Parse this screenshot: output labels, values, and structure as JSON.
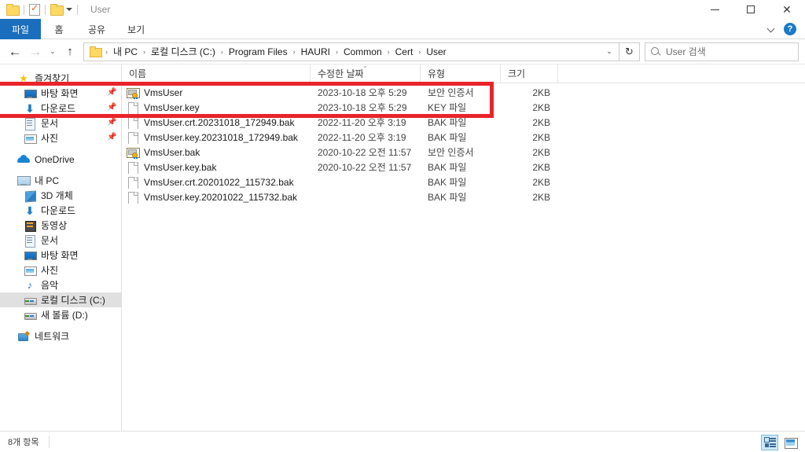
{
  "window": {
    "title": "User",
    "quick_access": [
      {
        "name": "folder-icon",
        "label": "새 폴더"
      },
      {
        "name": "properties-icon",
        "label": "속성"
      },
      {
        "name": "folder-icon-2",
        "label": "폴더"
      }
    ],
    "controls": {
      "minimize": "—",
      "maximize": "□",
      "close": "✕"
    }
  },
  "ribbon": {
    "tabs": [
      {
        "label": "파일",
        "active": true
      },
      {
        "label": "홈",
        "active": false
      },
      {
        "label": "공유",
        "active": false
      },
      {
        "label": "보기",
        "active": false
      }
    ],
    "expand_icon": "chevron-down-icon",
    "help_label": "?"
  },
  "address": {
    "back_glyph": "←",
    "forward_glyph": "→",
    "history_glyph": "⌄",
    "up_glyph": "↑",
    "separator": "›",
    "dropdown_glyph": "⌄",
    "refresh_glyph": "↻",
    "crumbs": [
      "내 PC",
      "로컬 디스크 (C:)",
      "Program Files",
      "HAURI",
      "Common",
      "Cert",
      "User"
    ]
  },
  "search": {
    "placeholder": "User 검색",
    "value": ""
  },
  "sidebar": {
    "groups": [
      {
        "items": [
          {
            "label": "즐겨찾기",
            "icon": "star-icon",
            "indent": 0,
            "pinned": false,
            "selected": false
          },
          {
            "label": "바탕 화면",
            "icon": "desktop-icon",
            "indent": 1,
            "pinned": true,
            "selected": false
          },
          {
            "label": "다운로드",
            "icon": "download-icon",
            "indent": 1,
            "pinned": true,
            "selected": false
          },
          {
            "label": "문서",
            "icon": "documents-icon",
            "indent": 1,
            "pinned": true,
            "selected": false
          },
          {
            "label": "사진",
            "icon": "pictures-icon",
            "indent": 1,
            "pinned": true,
            "selected": false
          }
        ]
      },
      {
        "items": [
          {
            "label": "OneDrive",
            "icon": "cloud-icon",
            "indent": 0,
            "pinned": false,
            "selected": false
          }
        ]
      },
      {
        "items": [
          {
            "label": "내 PC",
            "icon": "this-pc-icon",
            "indent": 0,
            "pinned": false,
            "selected": false
          },
          {
            "label": "3D 개체",
            "icon": "3d-objects-icon",
            "indent": 1,
            "pinned": false,
            "selected": false
          },
          {
            "label": "다운로드",
            "icon": "download-icon",
            "indent": 1,
            "pinned": false,
            "selected": false
          },
          {
            "label": "동영상",
            "icon": "videos-icon",
            "indent": 1,
            "pinned": false,
            "selected": false
          },
          {
            "label": "문서",
            "icon": "documents-icon",
            "indent": 1,
            "pinned": false,
            "selected": false
          },
          {
            "label": "바탕 화면",
            "icon": "desktop-icon",
            "indent": 1,
            "pinned": false,
            "selected": false
          },
          {
            "label": "사진",
            "icon": "pictures-icon",
            "indent": 1,
            "pinned": false,
            "selected": false
          },
          {
            "label": "음악",
            "icon": "music-icon",
            "indent": 1,
            "pinned": false,
            "selected": false
          },
          {
            "label": "로컬 디스크 (C:)",
            "icon": "harddisk-icon",
            "indent": 1,
            "pinned": false,
            "selected": true
          },
          {
            "label": "새 볼륨 (D:)",
            "icon": "harddisk-icon",
            "indent": 1,
            "pinned": false,
            "selected": false
          }
        ]
      },
      {
        "items": [
          {
            "label": "네트워크",
            "icon": "network-icon",
            "indent": 0,
            "pinned": false,
            "selected": false
          }
        ]
      }
    ]
  },
  "filelist": {
    "columns": [
      {
        "label": "이름",
        "key": "name",
        "sorted": false
      },
      {
        "label": "수정한 날짜",
        "key": "date",
        "sorted": true,
        "sort_glyph": "⌄"
      },
      {
        "label": "유형",
        "key": "type",
        "sorted": false
      },
      {
        "label": "크기",
        "key": "size",
        "sorted": false
      }
    ],
    "rows": [
      {
        "name": "VmsUser",
        "icon": "certificate-icon",
        "date": "2023-10-18 오후 5:29",
        "type": "보안 인증서",
        "size": "2KB"
      },
      {
        "name": "VmsUser.key",
        "icon": "file-icon",
        "date": "2023-10-18 오후 5:29",
        "type": "KEY 파일",
        "size": "2KB"
      },
      {
        "name": "VmsUser.crt.20231018_172949.bak",
        "icon": "file-icon",
        "date": "2022-11-20 오후 3:19",
        "type": "BAK 파일",
        "size": "2KB"
      },
      {
        "name": "VmsUser.key.20231018_172949.bak",
        "icon": "file-icon",
        "date": "2022-11-20 오후 3:19",
        "type": "BAK 파일",
        "size": "2KB"
      },
      {
        "name": "VmsUser.bak",
        "icon": "certificate-icon",
        "date": "2020-10-22 오전 11:57",
        "type": "보안 인증서",
        "size": "2KB"
      },
      {
        "name": "VmsUser.key.bak",
        "icon": "file-icon",
        "date": "2020-10-22 오전 11:57",
        "type": "BAK 파일",
        "size": "2KB"
      },
      {
        "name": "VmsUser.crt.20201022_115732.bak",
        "icon": "file-icon",
        "date": "",
        "type": "BAK 파일",
        "size": "2KB"
      },
      {
        "name": "VmsUser.key.20201022_115732.bak",
        "icon": "file-icon",
        "date": "",
        "type": "BAK 파일",
        "size": "2KB"
      }
    ]
  },
  "annotation": {
    "color": "#e8242a",
    "covers_rows": [
      0,
      1
    ]
  },
  "statusbar": {
    "item_count": "8개 항목",
    "view_buttons": [
      {
        "name": "details-view",
        "active": true
      },
      {
        "name": "large-icons-view",
        "active": false
      }
    ]
  }
}
